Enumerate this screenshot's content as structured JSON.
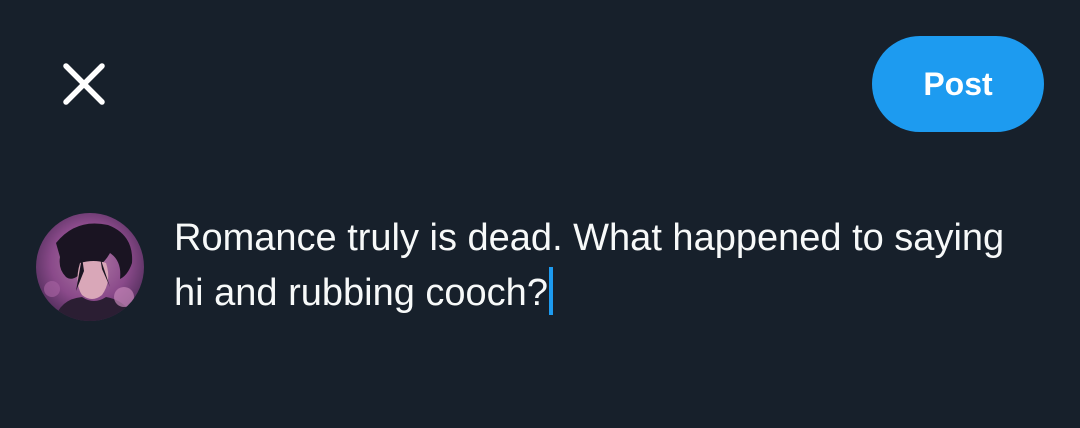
{
  "toolbar": {
    "close_icon": "close-icon",
    "post_label": "Post",
    "accent_color": "#1d9bf0"
  },
  "composer": {
    "avatar_icon": "user-avatar",
    "text": "Romance truly is dead. What happened to saying hi and rubbing cooch?"
  },
  "theme": {
    "background": "#17202b",
    "text_color": "#f7f9f9"
  }
}
